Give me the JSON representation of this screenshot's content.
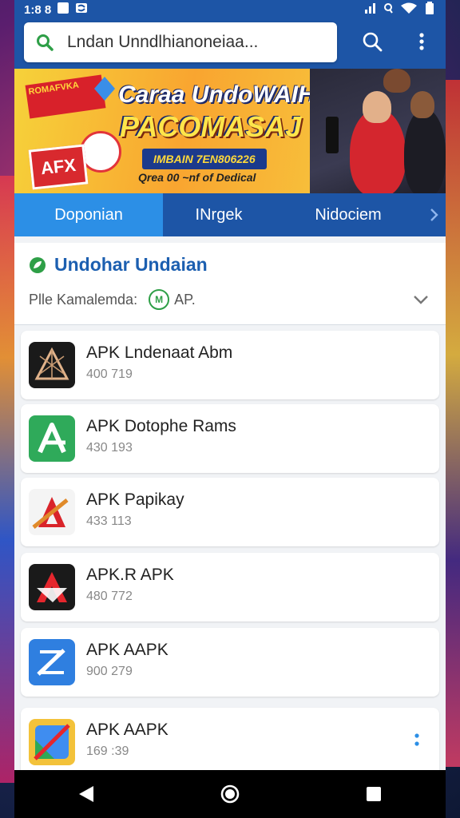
{
  "status": {
    "time": "1:8 8"
  },
  "search": {
    "value": "Lndan Unndlhianoneiaa..."
  },
  "banner": {
    "tag": "ROMAFVKA",
    "apk_label": "AFX",
    "title_line1": "Caraa UndoWAIH",
    "title_line2": "PACOMASAJ",
    "badge": "IMBAIN 7EN806226",
    "footer": "Qrea 00 ~nf of Dedical"
  },
  "tabs": [
    {
      "label": "Doponian",
      "active": true
    },
    {
      "label": "INrgek",
      "active": false
    },
    {
      "label": "Nidociem",
      "active": false
    }
  ],
  "filter": {
    "title": "Undohar Undaian",
    "label": "Plle Kamalemda:",
    "chip_icon_text": "M",
    "chip_value": "AP."
  },
  "apps": [
    {
      "title": "APK Lndenaat Abm",
      "subtitle": "400 719",
      "icon": "web-triangle-icon",
      "color": "#1a1a1a"
    },
    {
      "title": "APK Dotophe Rams",
      "subtitle": "430 193",
      "icon": "green-a-icon",
      "color": "#2faa5a"
    },
    {
      "title": "APK Papikay",
      "subtitle": "433 113",
      "icon": "red-a-slash-icon",
      "color": "#f4f4f4"
    },
    {
      "title": "APK.R APK",
      "subtitle": "480 772",
      "icon": "red-a-dark-icon",
      "color": "#1a1a1a"
    },
    {
      "title": "APK AAPK",
      "subtitle": "900 279",
      "icon": "blue-z-icon",
      "color": "#2f7fe0"
    },
    {
      "title": "APK AAPK",
      "subtitle": "169 :39",
      "icon": "yellow-slash-icon",
      "color": "#f3c23a"
    }
  ],
  "colors": {
    "primary": "#1d55a6",
    "accent": "#2c8fe6",
    "title_blue": "#1c5fb0"
  }
}
